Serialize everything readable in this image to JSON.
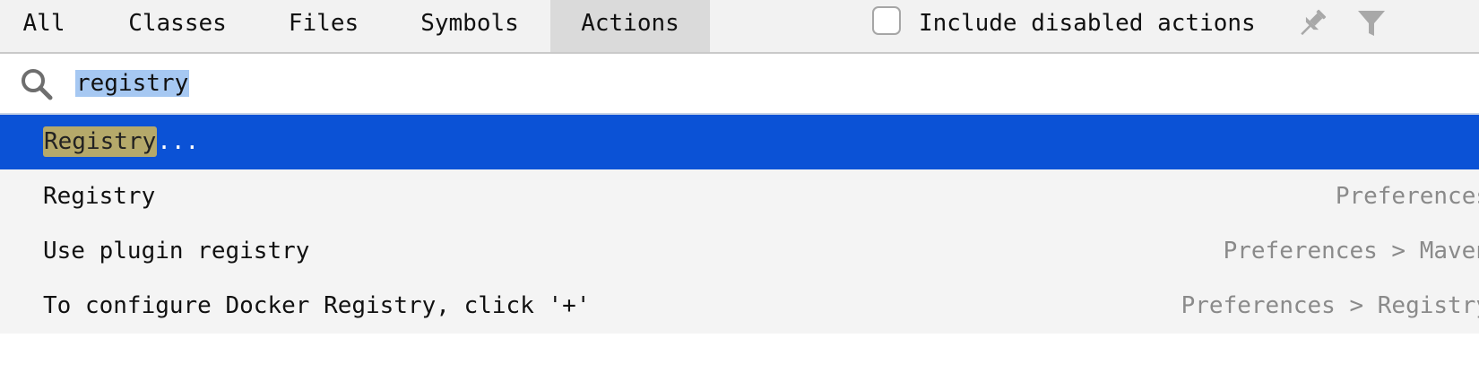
{
  "tabs": {
    "all": "All",
    "classes": "Classes",
    "files": "Files",
    "symbols": "Symbols",
    "actions": "Actions",
    "active": "actions"
  },
  "options": {
    "include_disabled_label": "Include disabled actions",
    "include_disabled_checked": false,
    "pin_icon": "pin-icon",
    "filter_icon": "filter-icon"
  },
  "search": {
    "icon": "search-icon",
    "value": "registry"
  },
  "results": [
    {
      "name_match": "Registry",
      "name_rest": "...",
      "location": "",
      "selected": true
    },
    {
      "name_match": "",
      "name_rest": "Registry",
      "location": "Preferences",
      "selected": false
    },
    {
      "name_match": "",
      "name_rest": "Use plugin registry",
      "location": "Preferences > Maven",
      "selected": false
    },
    {
      "name_match": "",
      "name_rest": "To configure Docker Registry, click '+'",
      "location": "Preferences > Registry",
      "selected": false
    }
  ],
  "colors": {
    "selection": "#0b52d6",
    "match_highlight": "#b5a96a",
    "search_selection": "#a6c8f2"
  }
}
